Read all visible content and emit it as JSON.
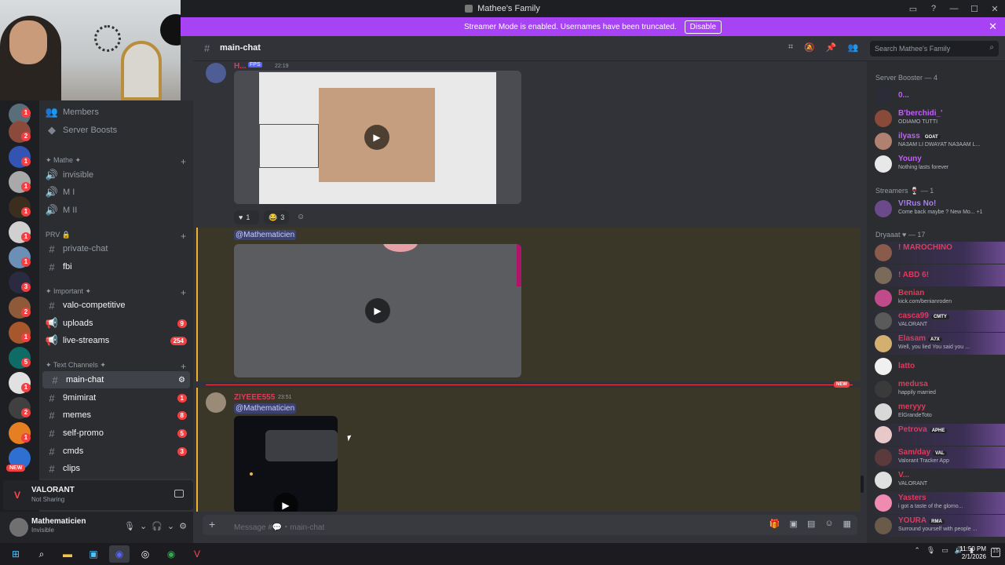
{
  "window": {
    "title": "Mathee's Family"
  },
  "banner": {
    "text": "Streamer Mode is enabled. Usernames have been truncated.",
    "disable_label": "Disable"
  },
  "sidebar": {
    "top_items": [
      {
        "label": "Members"
      },
      {
        "label": "Server Boosts"
      }
    ],
    "categories": [
      {
        "label": "✦ Mathe ✦",
        "channels": [
          "invisible",
          "M I",
          "M II"
        ]
      },
      {
        "label": "PRV 🔒",
        "channels": [
          "private-chat",
          "fbi"
        ]
      },
      {
        "label": "✦ Important ✦",
        "channels": [
          "valo-competitive",
          "uploads",
          "live-streams"
        ]
      },
      {
        "label": "✦ Text Channels ✦",
        "channels": [
          "main-chat",
          "9mimirat",
          "memes",
          "self-promo",
          "cmds",
          "clips"
        ]
      }
    ],
    "counts": {
      "uploads": "9",
      "live-streams": "254",
      "9mimirat": "1",
      "memes": "8",
      "self-promo": "5",
      "cmds": "3"
    }
  },
  "server_badges": [
    "1",
    "2",
    "1",
    "1",
    "1",
    "1",
    "1",
    "3",
    "2",
    "1",
    "5",
    "1",
    "2",
    "1"
  ],
  "server_new": "NEW",
  "activity": {
    "game": "VALORANT",
    "status": "Not Sharing"
  },
  "user": {
    "name": "Mathematicien",
    "status": "Invisible"
  },
  "header": {
    "channel": "main-chat",
    "search_placeholder": "Search Mathee's Family"
  },
  "messages": [
    {
      "author": "H...",
      "badge": "FPS",
      "time": "22:19",
      "reactions": [
        {
          "emoji": "♥",
          "count": "1"
        },
        {
          "emoji": "😂",
          "count": "3"
        }
      ]
    },
    {
      "mention": "@Mathematicien"
    },
    {
      "author": "ZIYEEE555",
      "time": "23:51",
      "mention": "@Mathematicien"
    }
  ],
  "new_tag": "NEW",
  "composer": {
    "placeholder": "Message #💬・main-chat"
  },
  "members": {
    "groups": [
      {
        "title": "Server Booster — 4",
        "items": [
          {
            "name": "0...",
            "status": "",
            "color": "#c35ef8"
          },
          {
            "name": "B'berchidi_'",
            "status": "ODIAMO TUTTI",
            "color": "#c35ef8"
          },
          {
            "name": "ilyass",
            "tag": "GOAT",
            "status": "NA3AM LI DWAYAT NA3AAM L...",
            "color": "#c35ef8"
          },
          {
            "name": "Youny",
            "status": "Nothing lasts forever",
            "color": "#c35ef8"
          }
        ]
      },
      {
        "title": "Streamers 🍷 — 1",
        "items": [
          {
            "name": "V!Rus No!",
            "status": "Come back maybe ? New Mo... +1",
            "color": "#a97df5"
          }
        ]
      },
      {
        "title": "Dryaaat ♥ — 17",
        "items": [
          {
            "name": "! MAROCHINO",
            "status": "",
            "color": "#e03a5c"
          },
          {
            "name": "! ABD 6!",
            "status": "",
            "color": "#e03a5c"
          },
          {
            "name": "Benian",
            "status": "kick.com/benianroden",
            "color": "#e03a5c"
          },
          {
            "name": "casca99",
            "tag": "CMTY",
            "status": "VALORANT",
            "color": "#e03a5c"
          },
          {
            "name": "Elasam",
            "tag": "A7X",
            "status": "Well, you lied You said you ...",
            "color": "#e03a5c"
          },
          {
            "name": "latto",
            "status": "",
            "color": "#e03a5c"
          },
          {
            "name": "medusa",
            "status": "happily married",
            "color": "#e03a5c"
          },
          {
            "name": "meryyy",
            "status": "ElGrandeToto",
            "color": "#e03a5c"
          },
          {
            "name": "Petrova",
            "tag": "APHE",
            "status": "",
            "color": "#e03a5c"
          },
          {
            "name": "Sam/day",
            "tag": "VAL",
            "status": "Valorant Tracker App",
            "color": "#e03a5c"
          },
          {
            "name": "V...",
            "status": "VALORANT",
            "color": "#e03a5c"
          },
          {
            "name": "Yasters",
            "status": "i got a taste of the glomo...",
            "color": "#e03a5c"
          },
          {
            "name": "YOURA",
            "tag": "RMA",
            "status": "Surround yourself with people ...",
            "color": "#e03a5c"
          }
        ]
      }
    ]
  },
  "taskbar": {
    "time": "11:50 PM",
    "date": "2/1/2026",
    "notif": "15"
  },
  "colors": {
    "accent": "#a742f5",
    "badge": "#f23f42",
    "mention": "#3c4270"
  }
}
